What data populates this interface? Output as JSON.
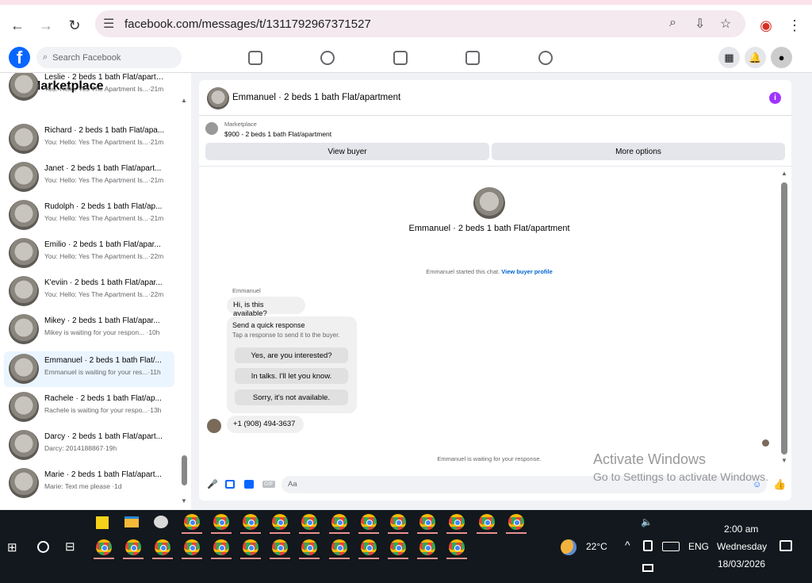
{
  "browser": {
    "url": "facebook.com/messages/t/1311792967371527"
  },
  "fb": {
    "search_placeholder": "Search Facebook"
  },
  "left": {
    "title": "Marketplace",
    "conversations": [
      {
        "name": "Leslie · 2 beds 1 bath Flat/apartment",
        "preview": "You: Hello: Yes The Apartment Is...·21m"
      },
      {
        "name": "Richard · 2 beds 1 bath Flat/apa...",
        "preview": "You: Hello: Yes The Apartment Is...·21m"
      },
      {
        "name": "Janet · 2 beds 1 bath Flat/apart...",
        "preview": "You: Hello: Yes The Apartment Is...·21m"
      },
      {
        "name": "Rudolph · 2 beds 1 bath Flat/ap...",
        "preview": "You: Hello: Yes The Apartment Is...·21m"
      },
      {
        "name": "Emilio · 2 beds 1 bath Flat/apar...",
        "preview": "You: Hello: Yes The Apartment Is...·22m"
      },
      {
        "name": "K'eviin · 2 beds 1 bath Flat/apar...",
        "preview": "You: Hello: Yes The Apartment Is...·22m"
      },
      {
        "name": "Mikey · 2 beds 1 bath Flat/apar...",
        "preview": "Mikey is waiting for your respon... ·10h"
      },
      {
        "name": "Emmanuel · 2 beds 1 bath Flat/...",
        "preview": "Emmanuel is waiting for your res...·11h"
      },
      {
        "name": "Rachele · 2 beds 1 bath Flat/ap...",
        "preview": "Rachele is waiting for your respo...·13h"
      },
      {
        "name": "Darcy · 2 beds 1 bath Flat/apart...",
        "preview": "Darcy: 2014188867·19h"
      },
      {
        "name": "Marie · 2 beds 1 bath Flat/apart...",
        "preview": "Marie: Text me please ·1d"
      }
    ]
  },
  "thread": {
    "title": "Emmanuel · 2 beds 1 bath Flat/apartment",
    "listing_source": "Marketplace",
    "listing": "$900 - 2 beds 1 bath Flat/apartment",
    "view_buyer": "View buyer",
    "more_options": "More options",
    "profile_name": "Emmanuel · 2 beds 1 bath Flat/apartment",
    "started_text": "Emmanuel started this chat.",
    "view_profile_link": "View buyer profile",
    "sender_label": "Emmanuel",
    "message1": "Hi, is this available?",
    "quick_title": "Send a quick response",
    "quick_sub": "Tap a response to send it to the buyer.",
    "quick_options": [
      "Yes, are you interested?",
      "In talks. I'll let you know.",
      "Sorry, it's not available."
    ],
    "phone_message": "+1 (908) 494-3637",
    "waiting_text": "Emmanuel is waiting for your response.",
    "composer_placeholder": "Aa"
  },
  "watermark": {
    "line1": "Activate Windows",
    "line2": "Go to Settings to activate Windows."
  },
  "taskbar": {
    "temperature": "22°C",
    "language": "ENG",
    "time": "2:00 am",
    "day": "Wednesday",
    "date": "18/03/2026"
  }
}
